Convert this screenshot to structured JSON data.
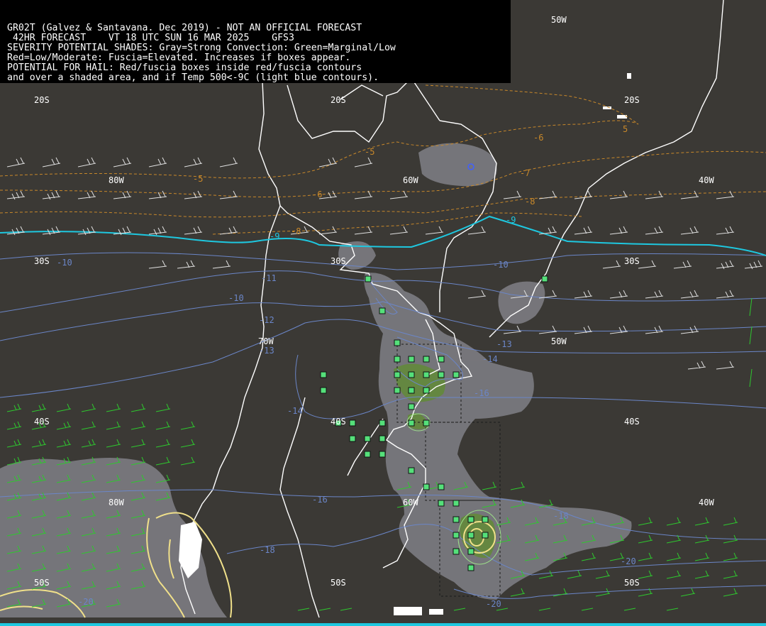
{
  "header": {
    "lines": [
      "GR02T (Galvez & Santavana. Dec 2019) - NOT AN OFFICIAL FORECAST",
      " 42HR FORECAST    VT 18 UTC SUN 16 MAR 2025    GFS3",
      "SEVERITY POTENTIAL SHADES: Gray=Strong Convection: Green=Marginal/Low",
      "Red=Low/Moderate: Fuscia=Elevated. Increases if boxes appear.",
      "POTENTIAL FOR HAIL: Red/fuscia boxes inside red/fuscia contours",
      "and over a shaded area, and if Temp 500<-9C (light blue contours)."
    ]
  },
  "grid_labels": {
    "lat_20s": "20S",
    "lat_30s": "30S",
    "lat_40s": "40S",
    "lat_50s": "50S",
    "lon_80w": "80W",
    "lon_70w": "70W",
    "lon_60w": "60W",
    "lon_50w": "50W",
    "lon_40w": "40W"
  },
  "contour_labels": {
    "t_-5": "-5",
    "t_-6": "-6",
    "t_-7": "-7",
    "t_-8": "-8",
    "t_-9": "-9",
    "t_-10": "-10",
    "t_-11": "-11",
    "t_-12": "-12",
    "t_-13": "-13",
    "t_-14": "-14",
    "t_-16": "-16",
    "t_-18": "-18",
    "t_-20": "-20",
    "y_5": "5"
  },
  "colors": {
    "background": "#3b3935",
    "header_bg": "#000000",
    "text": "#ffffff",
    "coast": "#ffffff",
    "isotherm_blue": "#6b86c8",
    "isotherm_minus9": "#1ec8e0",
    "isotherm_orange": "#c8882a",
    "gray_shade": "#8a8a92",
    "green_shade": "#5e8f2a",
    "box_green": "#55e07a",
    "yellow_contour": "#f0e08a",
    "wind_barb_white": "#e0e0e0",
    "wind_barb_green": "#2ec82e"
  }
}
